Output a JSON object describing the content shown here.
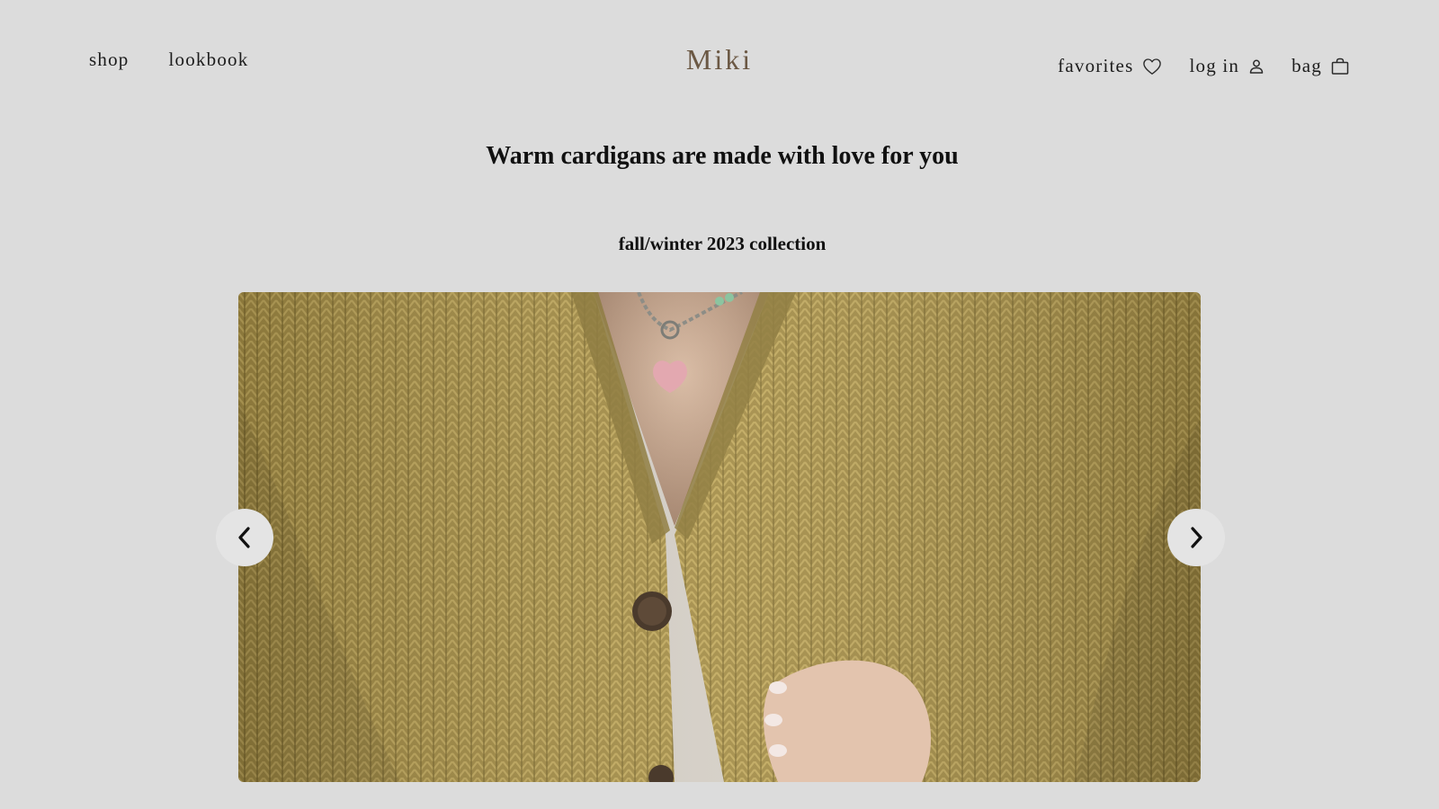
{
  "header": {
    "nav_left": [
      {
        "label": "shop"
      },
      {
        "label": "lookbook"
      }
    ],
    "logo": "Miki",
    "nav_right": {
      "favorites": {
        "label": "favorites",
        "icon": "heart-icon"
      },
      "login": {
        "label": "log in",
        "icon": "user-icon"
      },
      "bag": {
        "label": "bag",
        "icon": "shopping-bag-icon"
      }
    }
  },
  "hero": {
    "headline": "Warm cardigans are made with love for you",
    "subline": "fall/winter 2023 collection",
    "image_alt": "",
    "prev_icon": "chevron-left-icon",
    "next_icon": "chevron-right-icon"
  },
  "colors": {
    "background": "#dcdcdc",
    "logo": "#6b5844",
    "text": "#1c1c1c",
    "knit": "#a68f47"
  }
}
